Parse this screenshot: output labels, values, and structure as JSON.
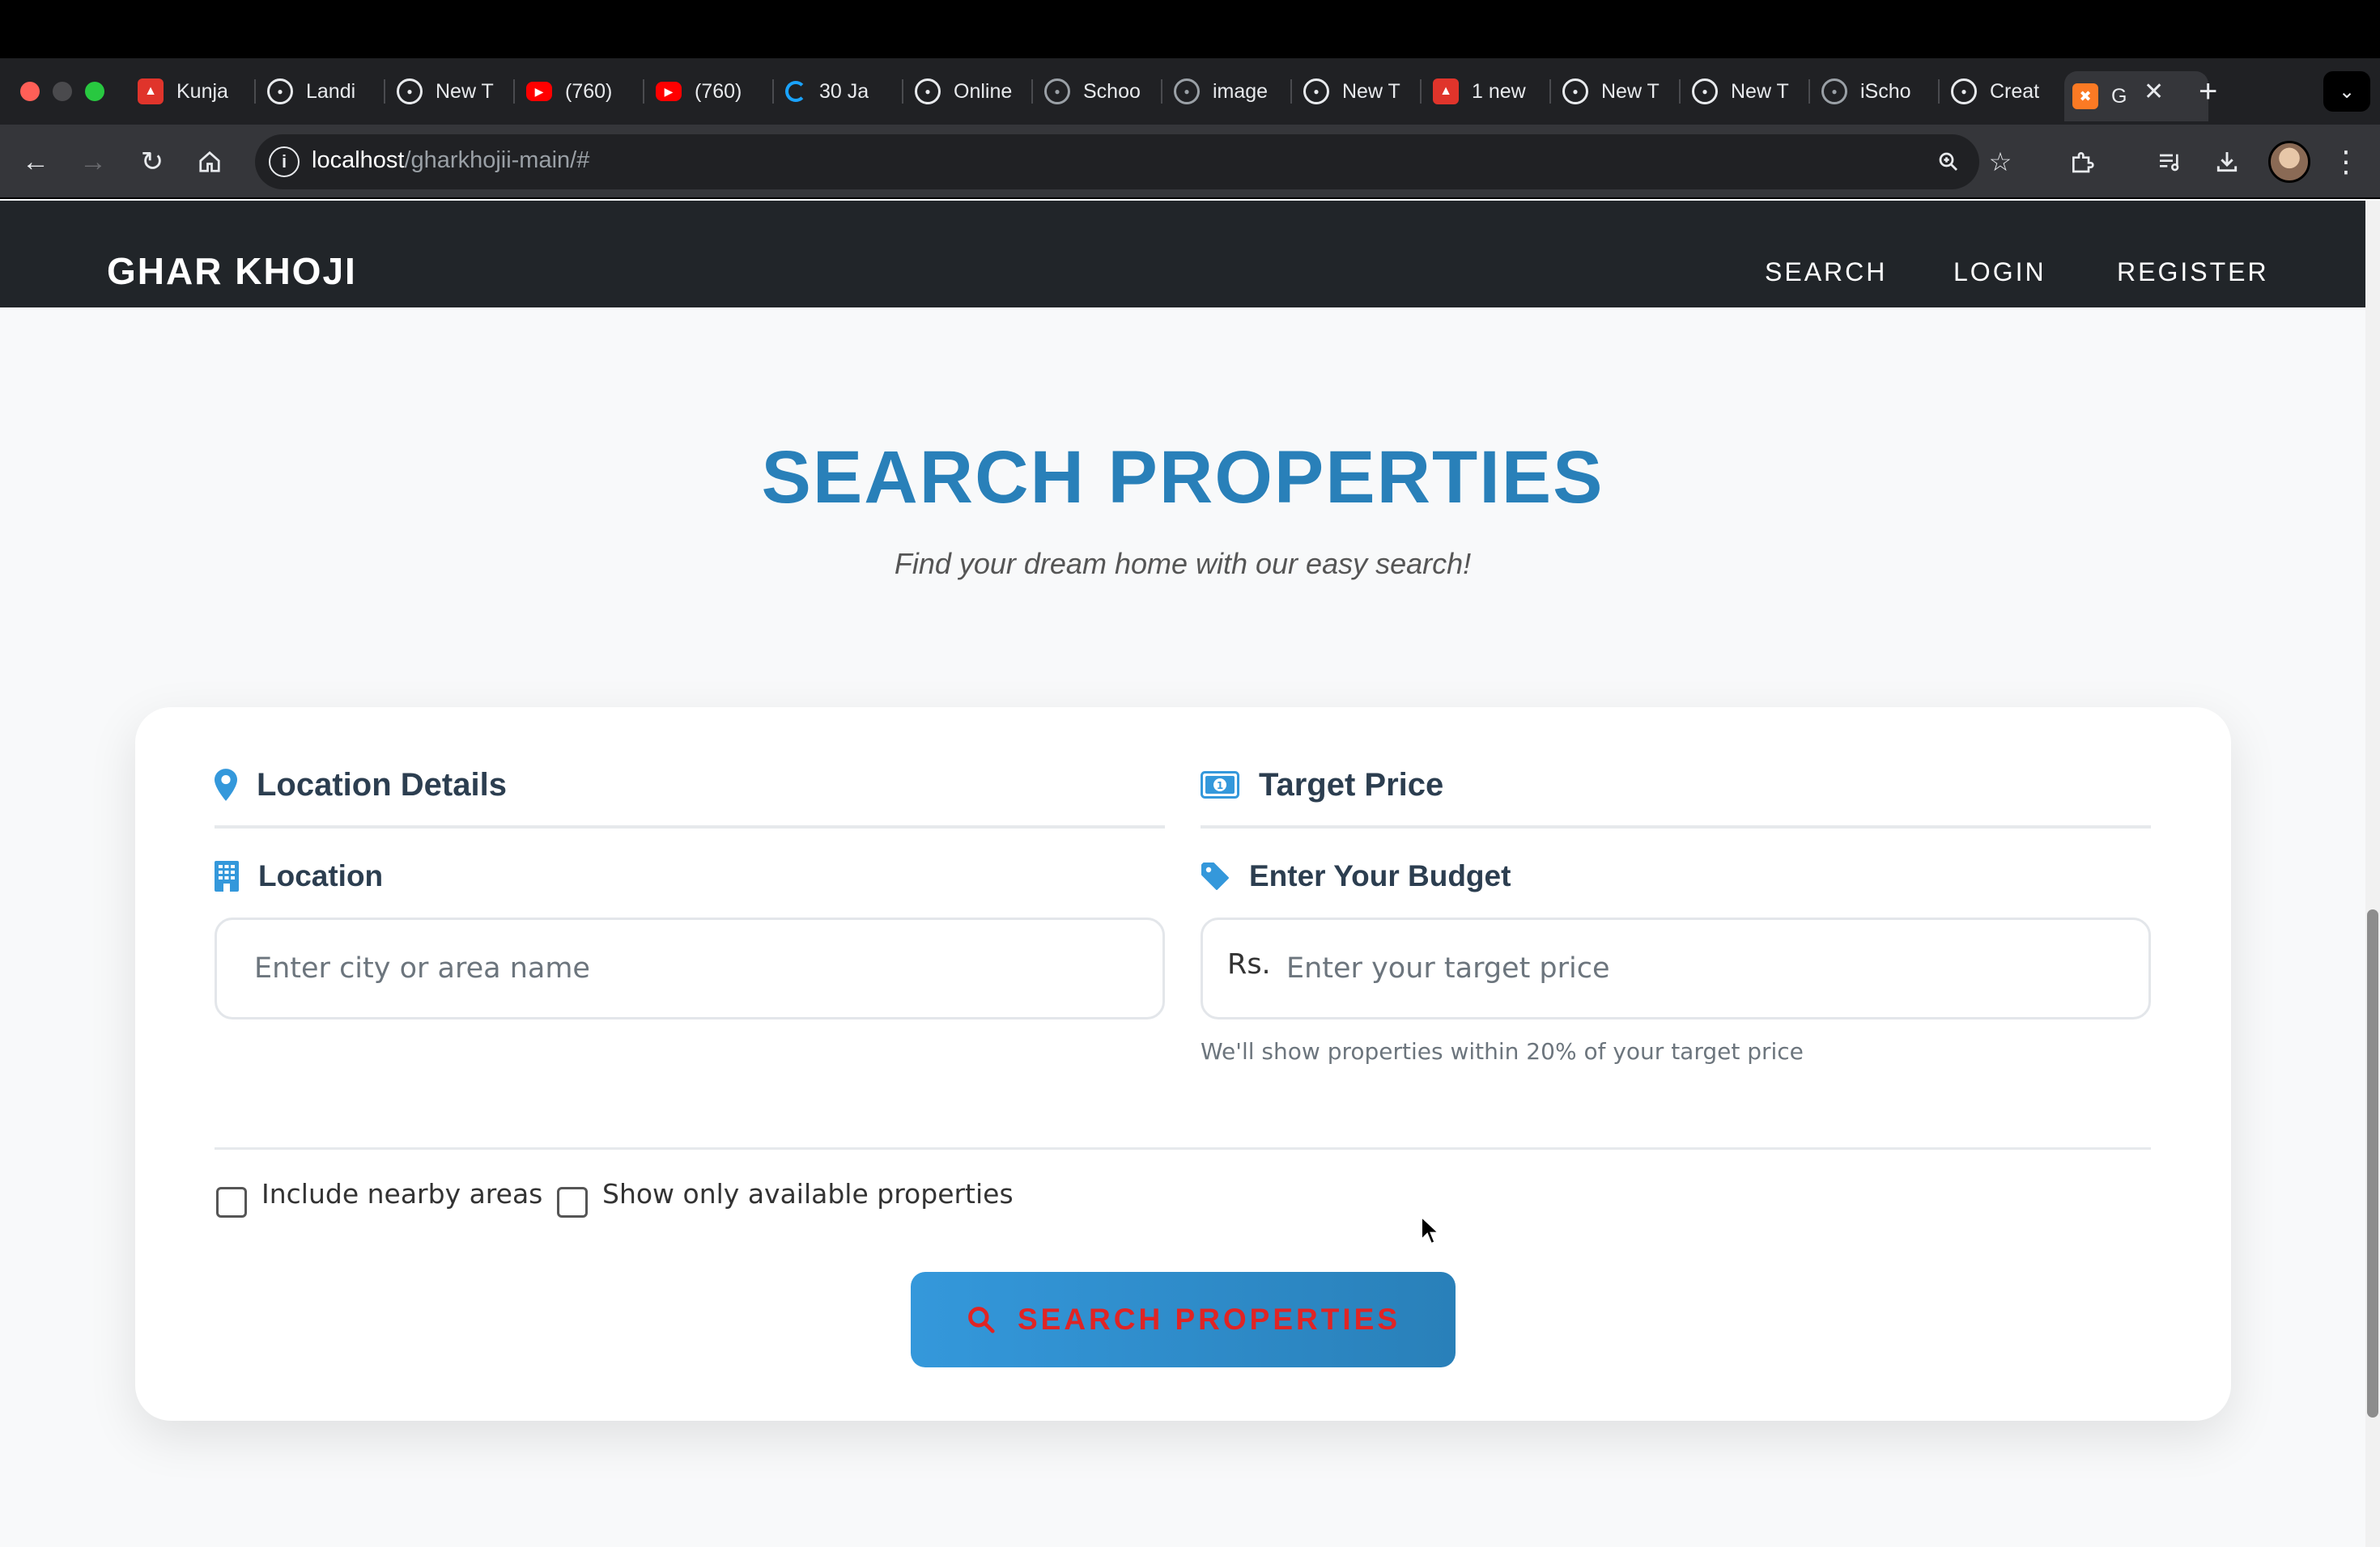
{
  "browser": {
    "tabs": [
      {
        "label": "Kunja",
        "icon": "laravel-icon",
        "color": "#e0342b"
      },
      {
        "label": "Landi",
        "icon": "openai-icon",
        "color": "#e8eaed"
      },
      {
        "label": "New T",
        "icon": "chrome-icon",
        "color": "#e8eaed"
      },
      {
        "label": "(760)",
        "icon": "youtube-icon",
        "color": "#ff0000"
      },
      {
        "label": "(760)",
        "icon": "youtube-icon",
        "color": "#ff0000"
      },
      {
        "label": "30 Ja",
        "icon": "loader-icon",
        "color": "#1aa3ff"
      },
      {
        "label": "Online",
        "icon": "github-icon",
        "color": "#e8eaed"
      },
      {
        "label": "Schoo",
        "icon": "globe-icon",
        "color": "#9aa0a6"
      },
      {
        "label": "image",
        "icon": "globe-icon",
        "color": "#9aa0a6"
      },
      {
        "label": "New T",
        "icon": "chrome-icon",
        "color": "#e8eaed"
      },
      {
        "label": "1 new",
        "icon": "laravel-icon",
        "color": "#e0342b"
      },
      {
        "label": "New T",
        "icon": "chrome-icon",
        "color": "#e8eaed"
      },
      {
        "label": "New T",
        "icon": "chrome-icon",
        "color": "#e8eaed"
      },
      {
        "label": "iScho",
        "icon": "globe-icon",
        "color": "#9aa0a6"
      },
      {
        "label": "Creat",
        "icon": "github-icon",
        "color": "#e8eaed"
      }
    ],
    "active_tab": {
      "label": "G",
      "icon": "xampp-icon",
      "color": "#fb7a24"
    },
    "url_host": "localhost",
    "url_path": "/gharkhojii-main/#"
  },
  "nav": {
    "brand": "GHAR KHOJI",
    "links": [
      "SEARCH",
      "LOGIN",
      "REGISTER"
    ]
  },
  "hero": {
    "title": "SEARCH PROPERTIES",
    "subtitle": "Find your dream home with our easy search!"
  },
  "form": {
    "location_section": {
      "heading": "Location Details",
      "field_label": "Location",
      "placeholder": "Enter city or area name",
      "value": ""
    },
    "price_section": {
      "heading": "Target Price",
      "field_label": "Enter Your Budget",
      "prefix": "Rs.",
      "placeholder": "Enter your target price",
      "value": "",
      "hint": "We'll show properties within 20% of your target price"
    },
    "options": [
      {
        "label": "Include nearby areas",
        "checked": false
      },
      {
        "label": "Show only available properties",
        "checked": false
      }
    ],
    "submit_label": "SEARCH PROPERTIES"
  },
  "colors": {
    "accent": "#2980b9",
    "icon": "#3498db",
    "heading": "#2c3e50",
    "nav_bg": "#212529",
    "button_text": "#e02424"
  }
}
